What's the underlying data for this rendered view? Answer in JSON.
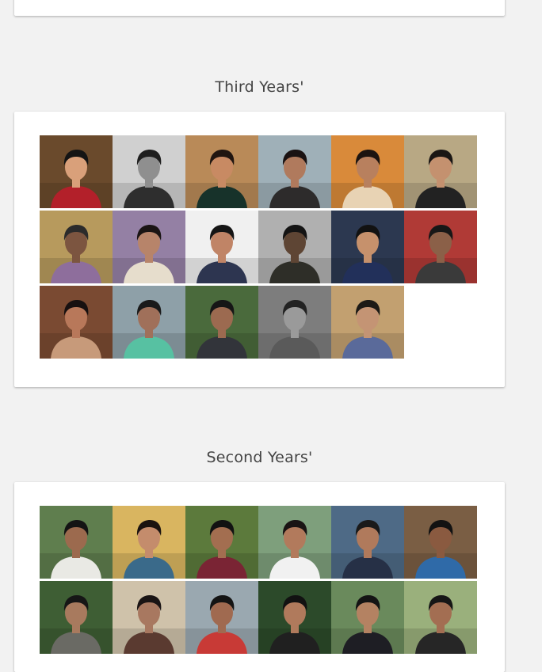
{
  "sections": {
    "third": {
      "title": "Third Years'"
    },
    "second": {
      "title": "Second Years'"
    }
  },
  "third_years": [
    {
      "bg": "#6a4a2c",
      "shirt": "#b3202a",
      "skin": "#d9a07a",
      "hair": "#141414"
    },
    {
      "bg": "#d0d0d0",
      "shirt": "#2e2e2e",
      "skin": "#8f8f8f",
      "hair": "#1e1e1e"
    },
    {
      "bg": "#b98a58",
      "shirt": "#17322a",
      "skin": "#c88a63",
      "hair": "#201510"
    },
    {
      "bg": "#9fb0b8",
      "shirt": "#2d2b2b",
      "skin": "#b07a5d",
      "hair": "#1a1212"
    },
    {
      "bg": "#d98a3a",
      "shirt": "#e8d3b4",
      "skin": "#b8805e",
      "hair": "#1c1410"
    },
    {
      "bg": "#b8a884",
      "shirt": "#222222",
      "skin": "#c4916f",
      "hair": "#1a1614"
    },
    {
      "bg": "#b79a5d",
      "shirt": "#8e6e9c",
      "skin": "#7c5540",
      "hair": "#2b2b2b"
    },
    {
      "bg": "#9480a4",
      "shirt": "#e6ddcc",
      "skin": "#b7846a",
      "hair": "#1a1414"
    },
    {
      "bg": "#f0f0f0",
      "shirt": "#2d3550",
      "skin": "#c08466",
      "hair": "#151515"
    },
    {
      "bg": "#b0b0b0",
      "shirt": "#2e2e28",
      "skin": "#5e4534",
      "hair": "#141414"
    },
    {
      "bg": "#2c3850",
      "shirt": "#22305a",
      "skin": "#c6916c",
      "hair": "#121212"
    },
    {
      "bg": "#b03a36",
      "shirt": "#3a3a3a",
      "skin": "#8b6048",
      "hair": "#171717"
    },
    {
      "bg": "#7a4a32",
      "shirt": "#c79a7a",
      "skin": "#b8785a",
      "hair": "#171010"
    },
    {
      "bg": "#8ea0a8",
      "shirt": "#57c1a2",
      "skin": "#a0705a",
      "hair": "#1a1a1a"
    },
    {
      "bg": "#4a6a3c",
      "shirt": "#32343a",
      "skin": "#9c6a50",
      "hair": "#161616"
    },
    {
      "bg": "#7d7d7d",
      "shirt": "#5a5a5a",
      "skin": "#9a9a9a",
      "hair": "#222222"
    },
    {
      "bg": "#c2a070",
      "shirt": "#5a6a9a",
      "skin": "#c49474",
      "hair": "#1d1a16"
    }
  ],
  "second_years": [
    {
      "bg": "#5f7e4e",
      "shirt": "#e9e9e4",
      "skin": "#9c6a4e",
      "hair": "#141414"
    },
    {
      "bg": "#d9b560",
      "shirt": "#3a6a8a",
      "skin": "#c48c6c",
      "hair": "#1b1310"
    },
    {
      "bg": "#5c7a3c",
      "shirt": "#7a2434",
      "skin": "#a36e50",
      "hair": "#121212"
    },
    {
      "bg": "#7e9f7c",
      "shirt": "#f1f1f1",
      "skin": "#b27a5c",
      "hair": "#1a1414"
    },
    {
      "bg": "#4e6a86",
      "shirt": "#263046",
      "skin": "#b07a5c",
      "hair": "#1a1a1a"
    },
    {
      "bg": "#7a5e44",
      "shirt": "#2f6aa8",
      "skin": "#8a5a40",
      "hair": "#121212"
    },
    {
      "bg": "#3e5e34",
      "shirt": "#6a6a64",
      "skin": "#a87a5e",
      "hair": "#161616"
    },
    {
      "bg": "#cfc2aa",
      "shirt": "#5a3a30",
      "skin": "#a87860",
      "hair": "#1a1414"
    },
    {
      "bg": "#9aa8b0",
      "shirt": "#c83a36",
      "skin": "#a06a50",
      "hair": "#141414"
    },
    {
      "bg": "#2c4a2a",
      "shirt": "#202020",
      "skin": "#b07a5c",
      "hair": "#121212"
    },
    {
      "bg": "#6a8a5c",
      "shirt": "#1e1e24",
      "skin": "#b48262",
      "hair": "#141414"
    },
    {
      "bg": "#9ab07c",
      "shirt": "#262626",
      "skin": "#a36e52",
      "hair": "#161616"
    }
  ]
}
